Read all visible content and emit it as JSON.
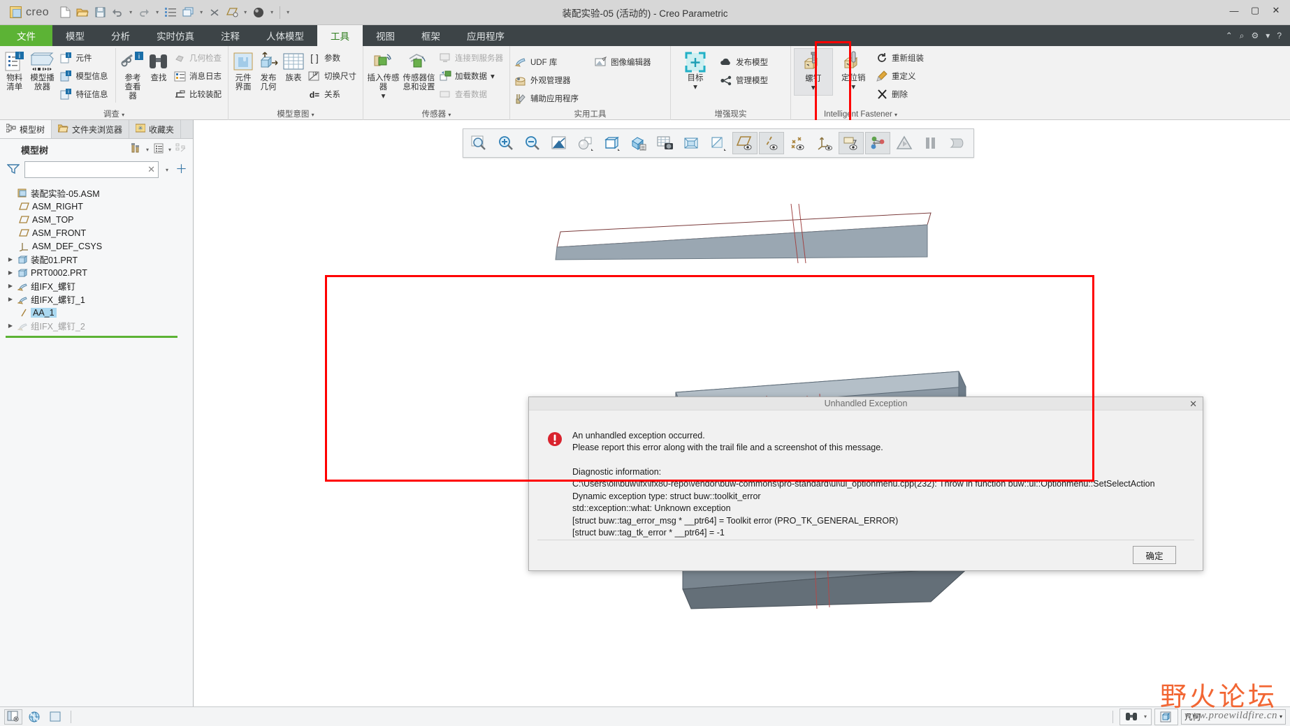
{
  "window": {
    "title": "装配实验-05 (活动的) - Creo Parametric",
    "brand": "creo",
    "minimize": "—",
    "maximize": "▢",
    "close": "✕"
  },
  "quick_access": {
    "items": [
      {
        "name": "new-file",
        "icon": "new-document-icon"
      },
      {
        "name": "open-file",
        "icon": "open-folder-icon"
      },
      {
        "name": "save-file",
        "icon": "save-disk-icon"
      },
      {
        "name": "undo",
        "icon": "undo-arrow-icon"
      },
      {
        "name": "redo",
        "icon": "redo-arrow-icon"
      },
      {
        "name": "regenerate",
        "icon": "regenerate-icon"
      },
      {
        "name": "window-switch",
        "icon": "window-icon"
      },
      {
        "name": "close-window",
        "icon": "close-x-icon"
      },
      {
        "name": "datum-display",
        "icon": "datum-plane-icon"
      },
      {
        "name": "display-style",
        "icon": "shaded-sphere-icon"
      }
    ]
  },
  "tabs": [
    {
      "label": "文件",
      "kind": "file"
    },
    {
      "label": "模型",
      "kind": "normal"
    },
    {
      "label": "分析",
      "kind": "normal"
    },
    {
      "label": "实时仿真",
      "kind": "normal"
    },
    {
      "label": "注释",
      "kind": "normal"
    },
    {
      "label": "人体模型",
      "kind": "normal"
    },
    {
      "label": "工具",
      "kind": "active"
    },
    {
      "label": "视图",
      "kind": "normal"
    },
    {
      "label": "框架",
      "kind": "normal"
    },
    {
      "label": "应用程序",
      "kind": "normal"
    }
  ],
  "ribbon": {
    "groups": [
      {
        "title": "调查",
        "has_dropdown": true,
        "big": [
          {
            "label": "物料清单",
            "icon": "bill-of-materials-icon"
          },
          {
            "label": "模型播放器",
            "icon": "model-player-icon"
          }
        ],
        "small": [
          {
            "label": "元件",
            "icon": "component-info-icon",
            "disabled": false
          },
          {
            "label": "模型信息",
            "icon": "model-info-icon",
            "disabled": false
          },
          {
            "label": "特征信息",
            "icon": "feature-info-icon",
            "disabled": false
          }
        ],
        "big2": [
          {
            "label": "参考查看器",
            "icon": "reference-viewer-icon"
          },
          {
            "label": "查找",
            "icon": "find-binoculars-icon"
          }
        ],
        "small2": [
          {
            "label": "几何检查",
            "icon": "geometry-check-icon",
            "disabled": true
          },
          {
            "label": "消息日志",
            "icon": "message-log-icon",
            "disabled": false
          },
          {
            "label": "比较装配",
            "icon": "compare-assembly-icon",
            "disabled": false
          }
        ]
      },
      {
        "title": "模型意图",
        "has_dropdown": true,
        "big": [
          {
            "label": "元件界面",
            "icon": "component-interface-icon"
          },
          {
            "label": "发布几何",
            "icon": "publish-geometry-icon"
          },
          {
            "label": "族表",
            "icon": "family-table-icon"
          }
        ],
        "small": [
          {
            "label": "参数",
            "icon": "parameters-icon",
            "disabled": false
          },
          {
            "label": "切换尺寸",
            "icon": "switch-dimensions-icon",
            "disabled": false
          },
          {
            "label": "关系",
            "icon": "relations-icon",
            "disabled": false
          }
        ]
      },
      {
        "title": "传感器",
        "has_dropdown": true,
        "big": [
          {
            "label": "插入传感器",
            "icon": "insert-sensor-icon",
            "dropdown": true
          },
          {
            "label": "传感器信息和设置",
            "icon": "sensor-settings-icon"
          }
        ],
        "small": [
          {
            "label": "连接到服务器",
            "icon": "connect-server-icon",
            "disabled": true
          },
          {
            "label": "加载数据",
            "icon": "load-data-icon",
            "disabled": false,
            "dropdown": true
          },
          {
            "label": "查看数据",
            "icon": "view-data-icon",
            "disabled": true
          }
        ]
      },
      {
        "title": "实用工具",
        "has_dropdown": false,
        "small": [
          {
            "label": "UDF 库",
            "icon": "udf-library-icon",
            "disabled": false
          },
          {
            "label": "外观管理器",
            "icon": "appearance-manager-icon",
            "disabled": false
          },
          {
            "label": "辅助应用程序",
            "icon": "auxiliary-apps-icon",
            "disabled": false
          }
        ],
        "small2": [
          {
            "label": "图像编辑器",
            "icon": "image-editor-icon",
            "disabled": false
          }
        ]
      },
      {
        "title": "增强现实",
        "has_dropdown": false,
        "big": [
          {
            "label": "目标",
            "icon": "ar-target-icon",
            "dropdown": true
          }
        ],
        "small": [
          {
            "label": "发布模型",
            "icon": "publish-model-cloud-icon",
            "disabled": false
          },
          {
            "label": "管理模型",
            "icon": "manage-model-share-icon",
            "disabled": false
          }
        ]
      },
      {
        "title": "Intelligent Fastener",
        "has_dropdown": true,
        "big": [
          {
            "label": "螺钉",
            "icon": "screw-fastener-icon",
            "dropdown": true,
            "highlighted": true
          },
          {
            "label": "定位销",
            "icon": "dowel-pin-icon",
            "dropdown": true
          }
        ],
        "small": [
          {
            "label": "重新组装",
            "icon": "reassemble-icon",
            "disabled": false
          },
          {
            "label": "重定义",
            "icon": "redefine-icon",
            "disabled": false
          },
          {
            "label": "删除",
            "icon": "delete-x-icon",
            "disabled": false
          }
        ]
      }
    ],
    "right_controls": [
      {
        "name": "collapse-ribbon",
        "icon": "chevron-up-icon"
      },
      {
        "name": "search-command",
        "icon": "search-icon"
      },
      {
        "name": "settings",
        "icon": "gear-icon"
      },
      {
        "name": "help",
        "icon": "help-question-icon"
      }
    ]
  },
  "left_panel": {
    "tabs": [
      {
        "label": "模型树",
        "icon": "model-tree-icon",
        "active": true
      },
      {
        "label": "文件夹浏览器",
        "icon": "folder-browser-icon",
        "active": false
      },
      {
        "label": "收藏夹",
        "icon": "favorites-star-icon",
        "active": false
      }
    ],
    "header_title": "模型树",
    "header_tools": [
      {
        "name": "tree-filters",
        "icon": "tree-tools-icon"
      },
      {
        "name": "tree-display",
        "icon": "tree-list-icon"
      },
      {
        "name": "tree-hide",
        "icon": "tree-hide-icon"
      }
    ],
    "filter": {
      "value": "",
      "placeholder": ""
    },
    "tree": [
      {
        "label": "装配实验-05.ASM",
        "icon": "assembly-icon",
        "indent": 0,
        "arrow": false,
        "selected": false,
        "dim": false
      },
      {
        "label": "ASM_RIGHT",
        "icon": "datum-plane-icon",
        "indent": 1,
        "arrow": false,
        "selected": false,
        "dim": false
      },
      {
        "label": "ASM_TOP",
        "icon": "datum-plane-icon",
        "indent": 1,
        "arrow": false,
        "selected": false,
        "dim": false
      },
      {
        "label": "ASM_FRONT",
        "icon": "datum-plane-icon",
        "indent": 1,
        "arrow": false,
        "selected": false,
        "dim": false
      },
      {
        "label": "ASM_DEF_CSYS",
        "icon": "coordinate-system-icon",
        "indent": 1,
        "arrow": false,
        "selected": false,
        "dim": false
      },
      {
        "label": "装配01.PRT",
        "icon": "part-icon",
        "indent": 0,
        "arrow": true,
        "selected": false,
        "dim": false
      },
      {
        "label": "PRT0002.PRT",
        "icon": "part-icon",
        "indent": 0,
        "arrow": true,
        "selected": false,
        "dim": false
      },
      {
        "label": "组IFX_螺钉",
        "icon": "group-icon",
        "indent": 0,
        "arrow": true,
        "selected": false,
        "dim": false
      },
      {
        "label": "组IFX_螺钉_1",
        "icon": "group-icon",
        "indent": 0,
        "arrow": true,
        "selected": false,
        "dim": false
      },
      {
        "label": "AA_1",
        "icon": "datum-axis-icon",
        "indent": 1,
        "arrow": false,
        "selected": true,
        "dim": false
      },
      {
        "label": "组IFX_螺钉_2",
        "icon": "group-icon",
        "indent": 0,
        "arrow": true,
        "selected": false,
        "dim": true
      }
    ]
  },
  "graphics_toolbar": {
    "buttons": [
      {
        "name": "refit-zoom",
        "icon": "zoom-fit-icon",
        "pressed": false
      },
      {
        "name": "zoom-in",
        "icon": "zoom-in-icon",
        "pressed": false
      },
      {
        "name": "zoom-out",
        "icon": "zoom-out-icon",
        "pressed": false
      },
      {
        "name": "repaint",
        "icon": "repaint-icon",
        "pressed": false
      },
      {
        "name": "display-style",
        "icon": "shaded-sphere-icon",
        "pressed": false
      },
      {
        "name": "saved-orientations",
        "icon": "cube-view-icon",
        "pressed": false
      },
      {
        "name": "view-manager",
        "icon": "view-manager-icon",
        "pressed": false
      },
      {
        "name": "scene-capture",
        "icon": "camera-render-icon",
        "pressed": false
      },
      {
        "name": "perspective-view",
        "icon": "perspective-cube-icon",
        "pressed": false
      },
      {
        "name": "section-display",
        "icon": "section-icon",
        "pressed": false
      },
      {
        "name": "datum-plane-display",
        "icon": "datum-plane-eye-icon",
        "pressed": true
      },
      {
        "name": "datum-axis-display",
        "icon": "datum-axis-eye-icon",
        "pressed": true
      },
      {
        "name": "datum-point-display",
        "icon": "datum-point-eye-icon",
        "pressed": false,
        "highlighted": true
      },
      {
        "name": "csys-display",
        "icon": "csys-eye-icon",
        "pressed": false
      },
      {
        "name": "annotation-display",
        "icon": "annotation-eye-icon",
        "pressed": true
      },
      {
        "name": "spin-center",
        "icon": "spin-center-icon",
        "pressed": true
      },
      {
        "name": "play-animation",
        "icon": "play-triangle-icon",
        "pressed": false
      },
      {
        "name": "pause",
        "icon": "pause-icon",
        "pressed": false
      },
      {
        "name": "stop",
        "icon": "stop-shape-icon",
        "pressed": false
      }
    ]
  },
  "dialog": {
    "title": "Unhandled Exception",
    "close_label": "✕",
    "icon": "error-exclamation-icon",
    "line1": "An unhandled exception occurred.",
    "line2": "Please report this error along with the trail file and a screenshot of this message.",
    "diag_heading": "Diagnostic information:",
    "diag_lines": [
      "C:\\Users\\oli\\buw\\ifx\\ifx80-repo\\vendor\\buw-commons\\pro-standard\\ui\\ui_optionmenu.cpp(232): Throw in function buw::ui::Optionmenu::SetSelectAction",
      "Dynamic exception type: struct buw::toolkit_error",
      "std::exception::what: Unknown exception",
      "[struct buw::tag_error_msg * __ptr64] = Toolkit error (PRO_TK_GENERAL_ERROR)",
      "[struct buw::tag_tk_error * __ptr64] = -1"
    ],
    "ok_label": "确定"
  },
  "status_bar": {
    "left_buttons": [
      {
        "name": "show-hide-navigator",
        "icon": "navigator-panel-icon"
      },
      {
        "name": "web-browser",
        "icon": "globe-browser-icon"
      },
      {
        "name": "graphics-window",
        "icon": "blank-window-icon"
      }
    ],
    "right_buttons": [
      {
        "name": "search-selection",
        "icon": "binoculars-icon"
      },
      {
        "name": "search-options",
        "icon": "chevron-down-icon"
      },
      {
        "name": "selection-filter-3d",
        "icon": "cube-select-icon"
      }
    ],
    "filter_combo": "几何"
  },
  "watermark": {
    "main": "野火论坛",
    "sub": "www.proewildfire.cn"
  },
  "colors": {
    "accent_green": "#5cb335",
    "tab_bar": "#3d4447",
    "highlight_red": "#ff0000",
    "selection_blue": "#aad8f0",
    "model_gray": "#8c98a3"
  }
}
